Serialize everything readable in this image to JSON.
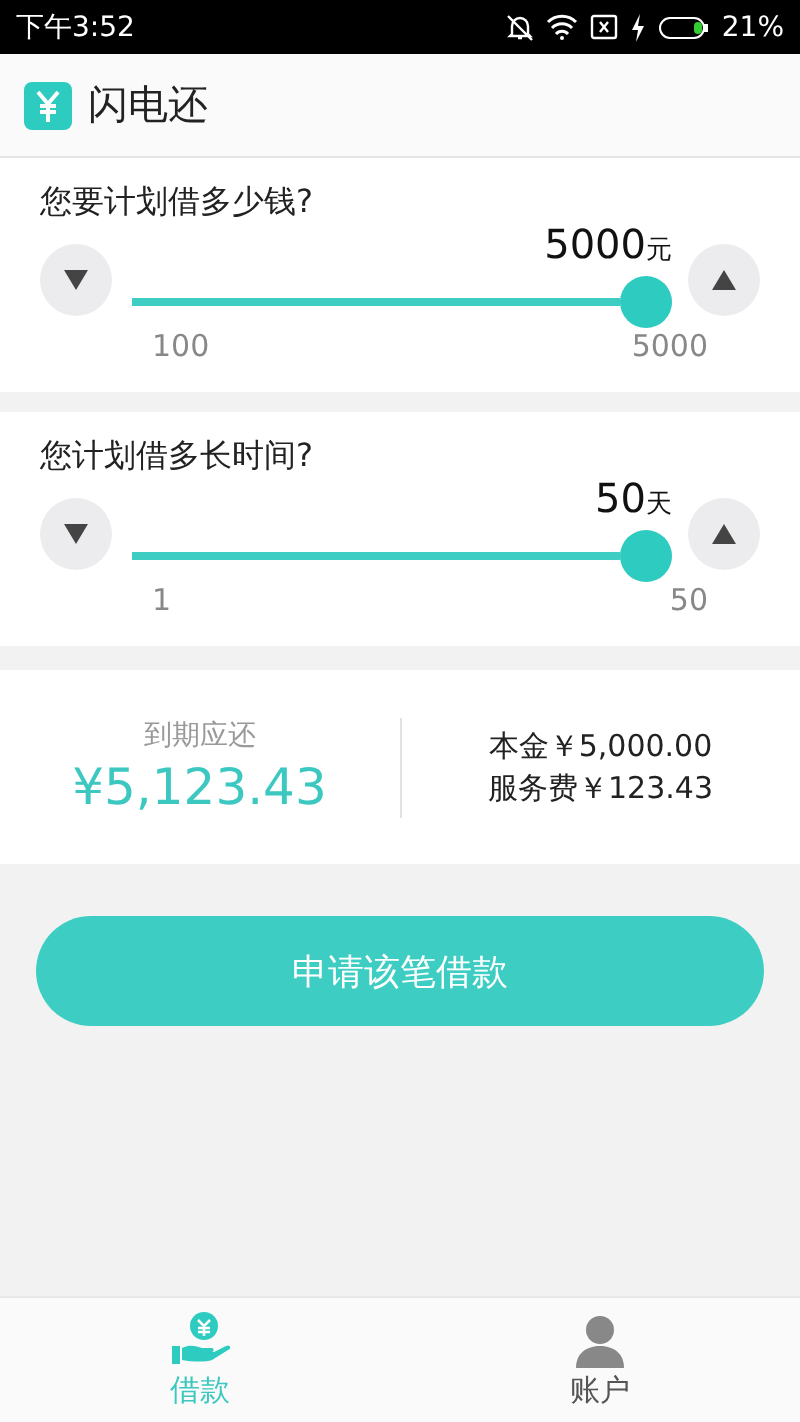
{
  "status_bar": {
    "time": "下午3:52",
    "battery": "21%"
  },
  "header": {
    "title": "闪电还"
  },
  "sliders": [
    {
      "question": "您要计划借多少钱?",
      "value": "5000",
      "unit": "元",
      "level": 1,
      "min": "100",
      "max": "5000"
    },
    {
      "question": "您计划借多长时间?",
      "value": "50",
      "unit": "天",
      "level": 1,
      "min": "1",
      "max": "50"
    }
  ],
  "summary": {
    "due_label": "到期应还",
    "due_amount": "¥5,123.43",
    "principal": "本金￥5,000.00",
    "fee": "服务费￥123.43"
  },
  "apply_button": "申请该笔借款",
  "tabs": [
    {
      "label": "借款",
      "selected": true,
      "kind": "loan"
    },
    {
      "label": "账户",
      "selected": false,
      "kind": "account"
    }
  ]
}
